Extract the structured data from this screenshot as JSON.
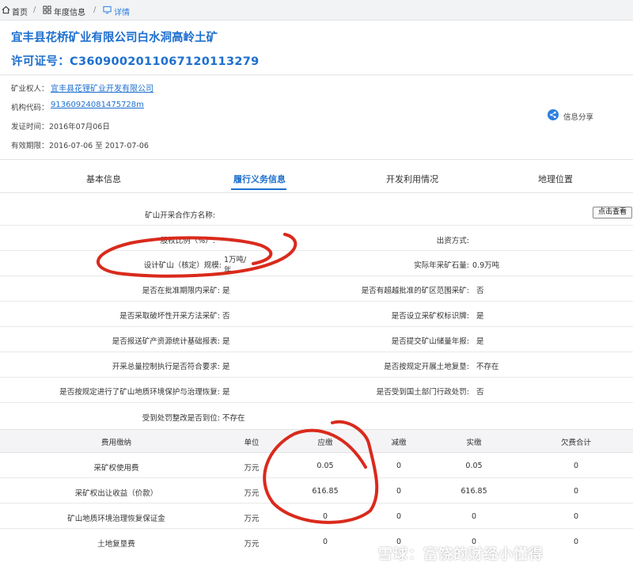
{
  "breadcrumb": {
    "home": "首页",
    "sep1": "/",
    "yearly": "年度信息",
    "sep2": "/",
    "current": "详情"
  },
  "header": {
    "title": "宜丰县花桥矿业有限公司白水洞高岭土矿",
    "license": "许可证号：C3609002011067120113279"
  },
  "meta": {
    "owner_label": "矿业权人：",
    "owner_value": "宜丰县花锂矿业开发有限公司",
    "code_label": "机构代码：",
    "code_value": "91360924081475728m",
    "issue_label": "发证时间：",
    "issue_value": "2016年07月06日",
    "valid_label": "有效期限：",
    "valid_value": "2016-07-06 至 2017-07-06"
  },
  "share_label": "信息分享",
  "tabs": [
    "基本信息",
    "履行义务信息",
    "开发利用情况",
    "地理位置"
  ],
  "rows": {
    "contract_label": "矿山开采合作方名称:",
    "contract_button": "点击查看",
    "equity_label": "股权比例（%）:",
    "investment_label": "出资方式:",
    "design_label": "设计矿山（核定）规模:",
    "design_value_1": "1万吨/",
    "design_value_2": "年",
    "actual_label": "实际年采矿石量:",
    "actual_value": "0.9万吨",
    "r1l": "是否在批准期限内采矿:",
    "r1lv": "是",
    "r1r": "是否有超越批准的矿区范围采矿:",
    "r1rv": "否",
    "r2l": "是否采取破坏性开采方法采矿:",
    "r2lv": "否",
    "r2r": "是否设立采矿权标识牌:",
    "r2rv": "是",
    "r3l": "是否报送矿产资源统计基础报表:",
    "r3lv": "是",
    "r3r": "是否提交矿山储量年报:",
    "r3rv": "是",
    "r4l": "开采总量控制执行是否符合要求:",
    "r4lv": "是",
    "r4r": "是否按规定开展土地复垦:",
    "r4rv": "不存在",
    "r5l": "是否按规定进行了矿山地质环境保护与治理恢复:",
    "r5lv": "是",
    "r5r": "是否受到国土部门行政处罚:",
    "r5rv": "否",
    "r6l": "受到处罚整改是否到位:",
    "r6lv": "不存在"
  },
  "fees": {
    "headers": [
      "费用缴纳",
      "单位",
      "应缴",
      "减缴",
      "实缴",
      "欠费合计"
    ],
    "rows": [
      [
        "采矿权使用费",
        "万元",
        "0.05",
        "0",
        "0.05",
        "0"
      ],
      [
        "采矿权出让收益（价款）",
        "万元",
        "616.85",
        "0",
        "616.85",
        "0"
      ],
      [
        "矿山地质环境治理恢复保证金",
        "万元",
        "0",
        "0",
        "0",
        "0"
      ],
      [
        "土地复垦费",
        "万元",
        "0",
        "0",
        "0",
        "0"
      ]
    ]
  },
  "watermark": "雪球：富饶的财经小懂得",
  "colors": {
    "link": "#1d6fce",
    "annotation": "#d92a1c"
  }
}
